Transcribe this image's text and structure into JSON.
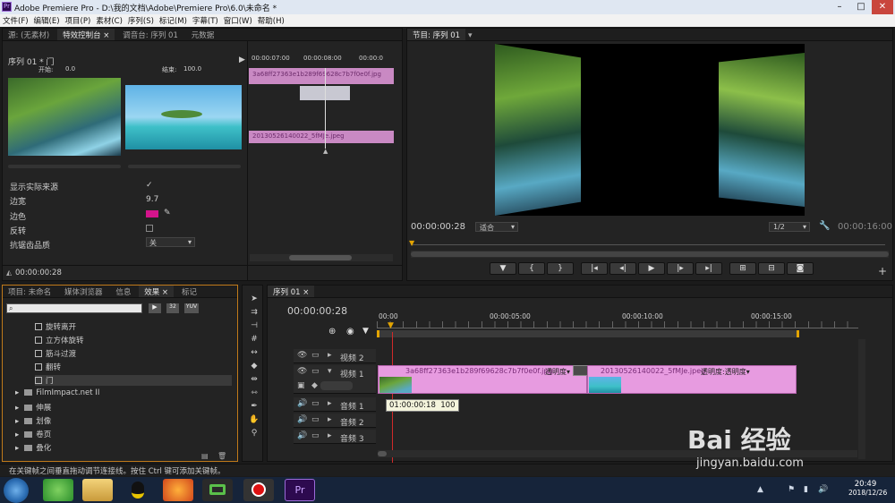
{
  "window": {
    "title": "Adobe Premiere Pro - D:\\我的文档\\Adobe\\Premiere Pro\\6.0\\未命名 *",
    "logo": "Pr"
  },
  "menu": [
    "文件(F)",
    "编辑(E)",
    "项目(P)",
    "素材(C)",
    "序列(S)",
    "标记(M)",
    "字幕(T)",
    "窗口(W)",
    "帮助(H)"
  ],
  "source_panel": {
    "tabs": [
      "源: (无素材)",
      "特效控制台 ×",
      "调音台: 序列 01",
      "元数据"
    ],
    "sequence_label": "序列 01 * 门",
    "start_label": "开始:",
    "start_value": "0.0",
    "end_label": "结束:",
    "end_value": "100.0",
    "timecodes": [
      "00:00:07:00",
      "00:00:08:00",
      "00:00:0"
    ],
    "clip_a": "3a68ff27363e1b289f69628c7b7f0e0f.jpg",
    "clip_b": "20130526140022_5fMJe.jpeg",
    "props": [
      {
        "label": "显示实际来源",
        "value": "✓"
      },
      {
        "label": "边宽",
        "value": "9.7"
      },
      {
        "label": "边色",
        "value": ""
      },
      {
        "label": "反转",
        "value": ""
      },
      {
        "label": "抗锯齿品质",
        "value": "关"
      }
    ],
    "current_tc": "00:00:00:28",
    "border_color": "#d4148c"
  },
  "program_panel": {
    "title": "节目: 序列 01",
    "timecode": "00:00:00:28",
    "fit": "适合",
    "quality": "1/2",
    "duration": "00:00:16:00",
    "transport": [
      "▼",
      "{",
      "}",
      "|◂",
      "◂|",
      "▶",
      "|▸",
      "▸|",
      "⊞",
      "⊟",
      "◙"
    ]
  },
  "project_panel": {
    "tabs": [
      "项目: 未命名",
      "媒体浏览器",
      "信息",
      "效果 ×",
      "标记"
    ],
    "search_placeholder": "",
    "badges": [
      "32",
      "YUV"
    ],
    "effects": [
      "旋转离开",
      "立方体旋转",
      "筋斗过渡",
      "翻转",
      "门"
    ],
    "folders": [
      "FilmImpact.net II",
      "伸展",
      "划像",
      "卷页",
      "叠化"
    ]
  },
  "timeline": {
    "tab": "序列 01 ×",
    "timecode": "00:00:00:28",
    "ruler": [
      "00:00",
      "00:00:05:00",
      "00:00:10:00",
      "00:00:15:00"
    ],
    "tracks": [
      "视频 2",
      "视频 1",
      "音频 1",
      "音频 2",
      "音频 3"
    ],
    "clip_a": "3a68ff27363e1b289f69628c7b7f0e0f.jpg",
    "clip_a_fx": "透明度▾",
    "clip_b": "20130526140022_5fMJe.jpeg",
    "clip_b_fx": "透明度:透明度▾",
    "tooltip_tc": "01:00:00:18",
    "tooltip_val": "100"
  },
  "statusbar": "在关键帧之间垂直拖动调节连接线。按住 Ctrl 键可添加关键帧。",
  "taskbar": {
    "time": "20:49",
    "date": "2018/12/26"
  },
  "watermark": {
    "brand": "Bai 经验",
    "url": "jingyan.baidu.com"
  }
}
